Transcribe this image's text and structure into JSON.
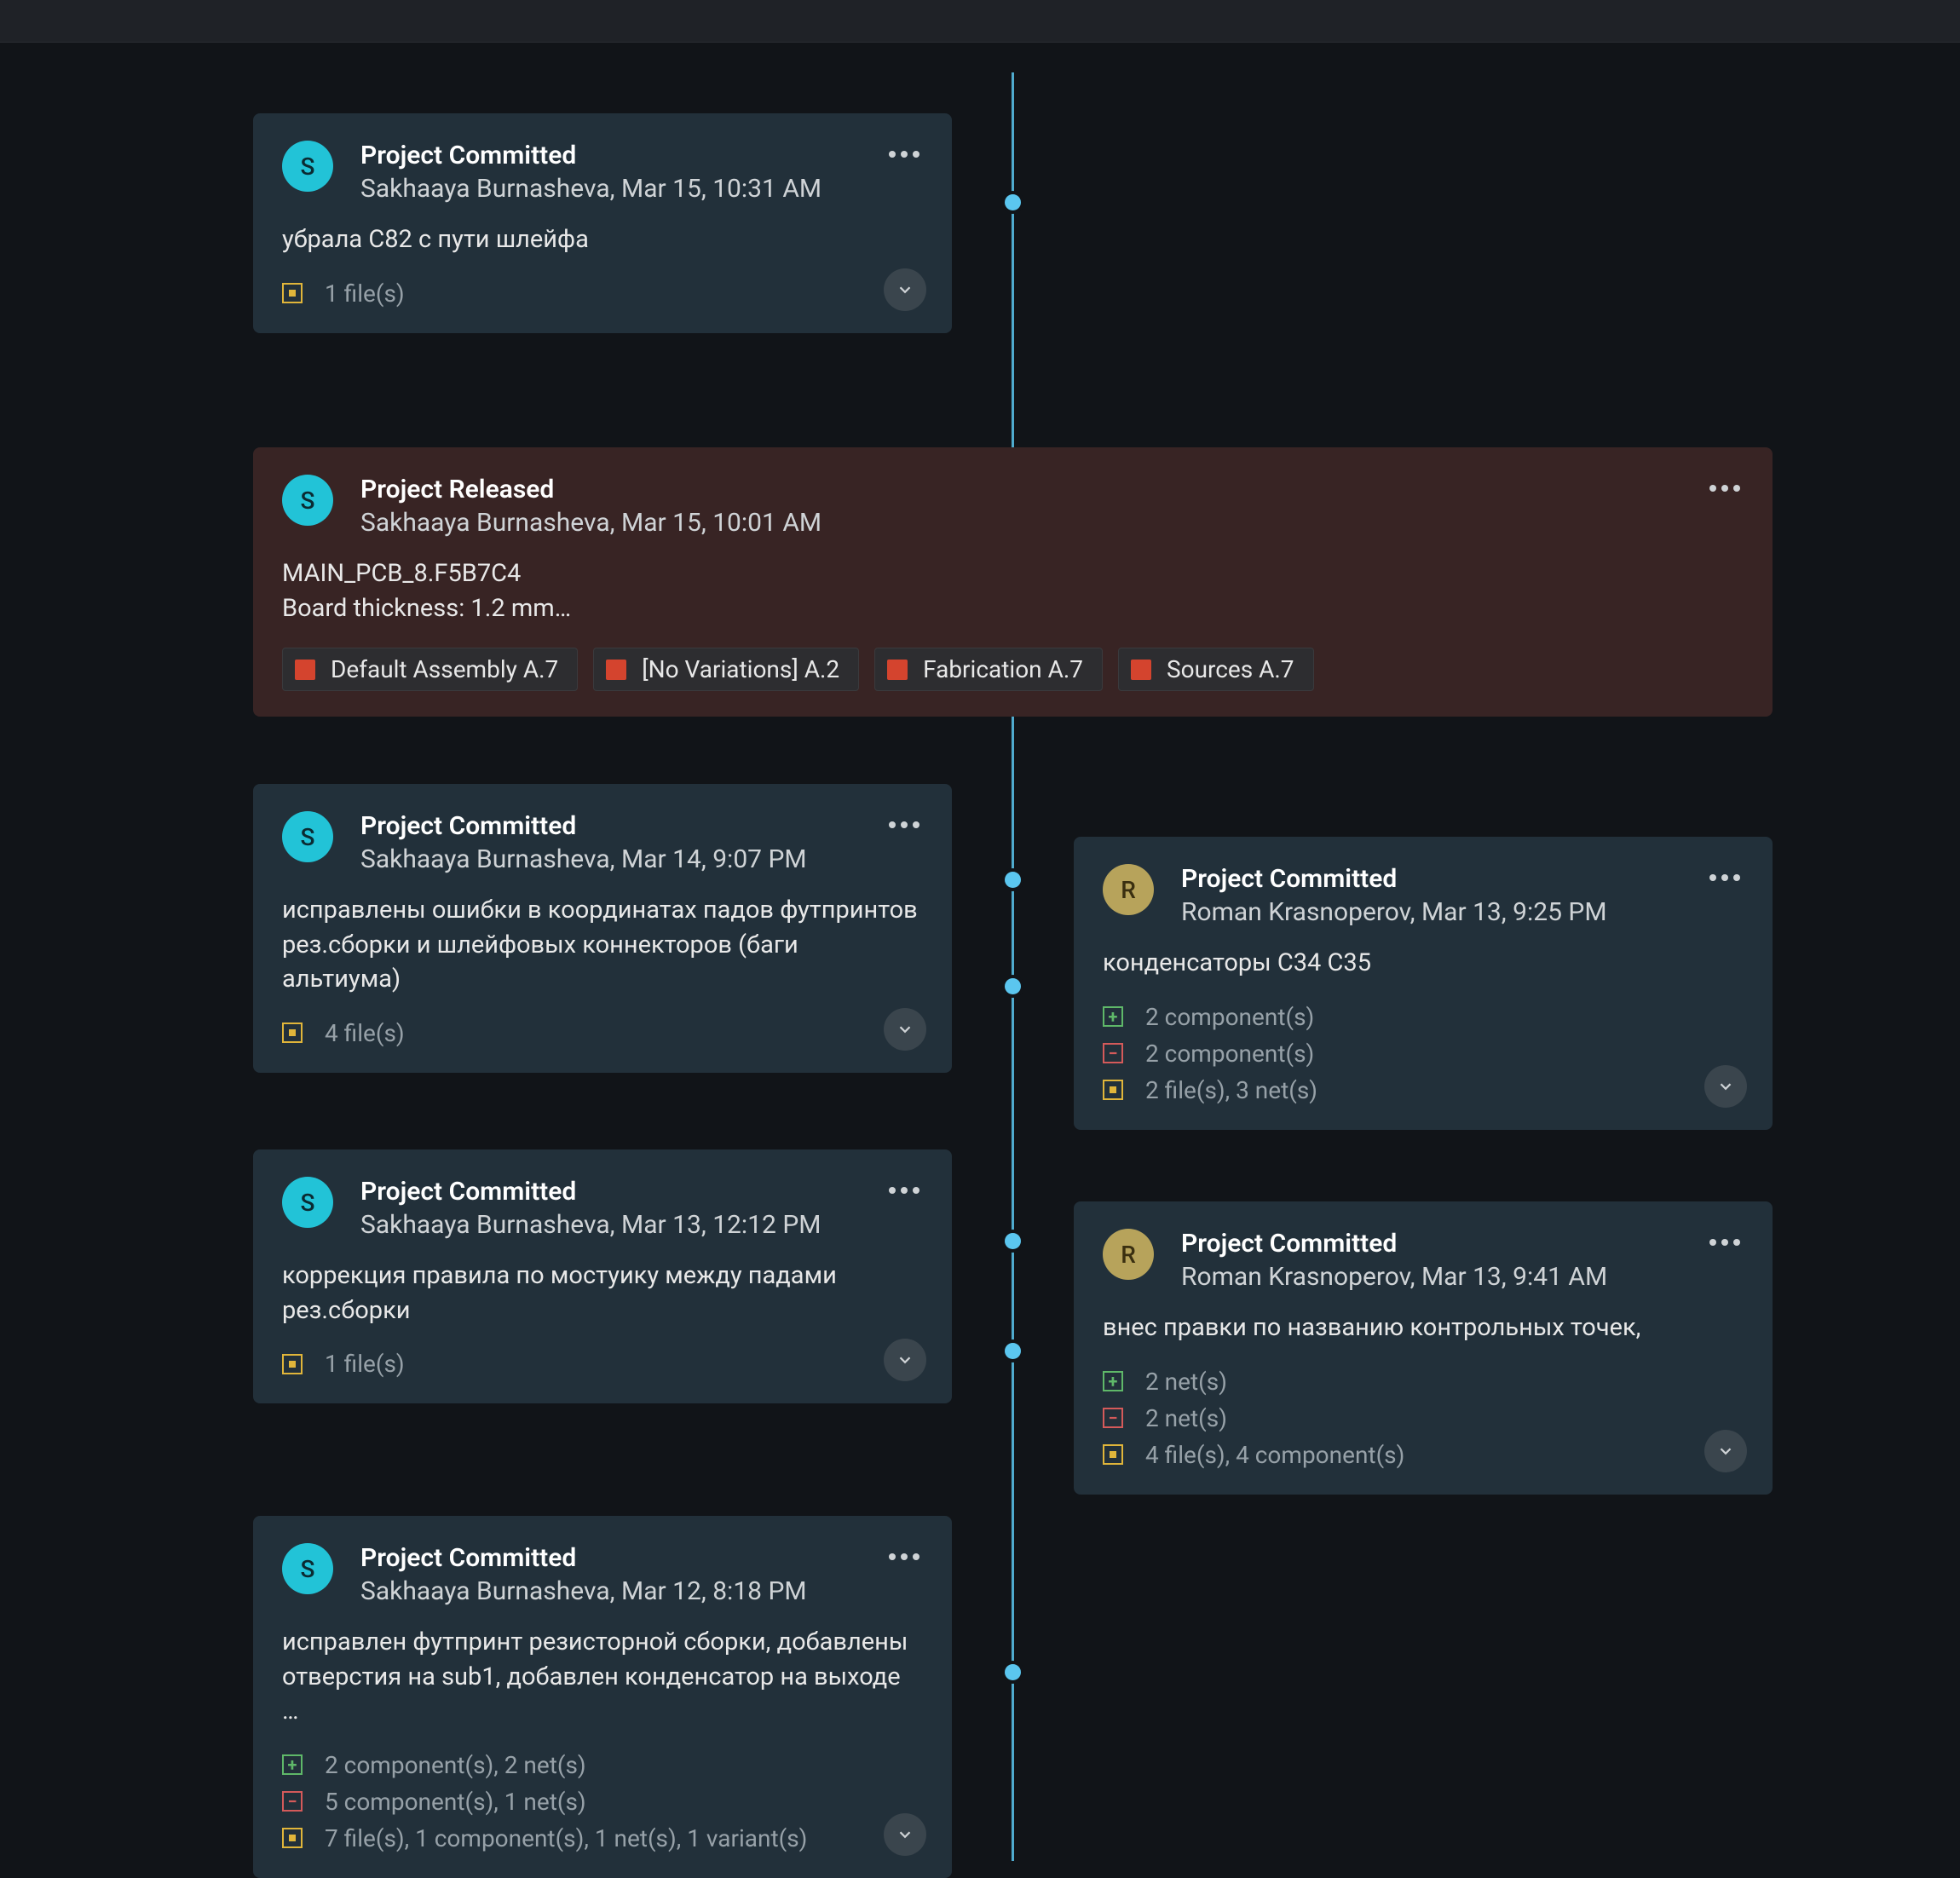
{
  "users": {
    "s": {
      "initial": "S",
      "name": "Sakhaaya Burnasheva"
    },
    "r": {
      "initial": "R",
      "name": "Roman Krasnoperov"
    }
  },
  "events": [
    {
      "id": "c1",
      "title": "Project Committed",
      "user": "s",
      "date": "Mar 15, 10:31 AM",
      "message": "убрала C82 с пути шлейфа",
      "stats": [
        {
          "type": "modified",
          "text": "1 file(s)"
        }
      ]
    },
    {
      "id": "rel1",
      "title": "Project Released",
      "user": "s",
      "date": "Mar 15, 10:01 AM",
      "message_line1": "MAIN_PCB_8.F5B7C4",
      "message_line2": "Board thickness: 1.2 mm…",
      "tags": [
        "Default Assembly A.7",
        "[No Variations] A.2",
        "Fabrication A.7",
        "Sources A.7"
      ]
    },
    {
      "id": "c2",
      "title": "Project Committed",
      "user": "s",
      "date": "Mar 14, 9:07 PM",
      "message": "исправлены ошибки в координатах падов футпринтов рез.сборки и шлейфовых коннекторов (баги альтиума)",
      "stats": [
        {
          "type": "modified",
          "text": "4 file(s)"
        }
      ]
    },
    {
      "id": "c3",
      "title": "Project Committed",
      "user": "r",
      "date": "Mar 13, 9:25 PM",
      "message": "конденсаторы C34 C35",
      "stats": [
        {
          "type": "added",
          "text": "2 component(s)"
        },
        {
          "type": "removed",
          "text": "2 component(s)"
        },
        {
          "type": "modified",
          "text": "2 file(s), 3 net(s)"
        }
      ]
    },
    {
      "id": "c4",
      "title": "Project Committed",
      "user": "s",
      "date": "Mar 13, 12:12 PM",
      "message": "коррекция правила по мостуику между падами рез.сборки",
      "stats": [
        {
          "type": "modified",
          "text": "1 file(s)"
        }
      ]
    },
    {
      "id": "c5",
      "title": "Project Committed",
      "user": "r",
      "date": "Mar 13, 9:41 AM",
      "message": "внес правки по названию контрольных точек,",
      "stats": [
        {
          "type": "added",
          "text": "2 net(s)"
        },
        {
          "type": "removed",
          "text": "2 net(s)"
        },
        {
          "type": "modified",
          "text": "4 file(s), 4 component(s)"
        }
      ]
    },
    {
      "id": "c6",
      "title": "Project Committed",
      "user": "s",
      "date": "Mar 12, 8:18 PM",
      "message": "исправлен футпринт резисторной сборки, добавлены отверстия на sub1, добавлен конденсатор на выходе …",
      "stats": [
        {
          "type": "added",
          "text": "2 component(s), 2 net(s)"
        },
        {
          "type": "removed",
          "text": "5 component(s), 1 net(s)"
        },
        {
          "type": "modified",
          "text": "7 file(s), 1 component(s), 1 net(s), 1 variant(s)"
        }
      ]
    }
  ]
}
